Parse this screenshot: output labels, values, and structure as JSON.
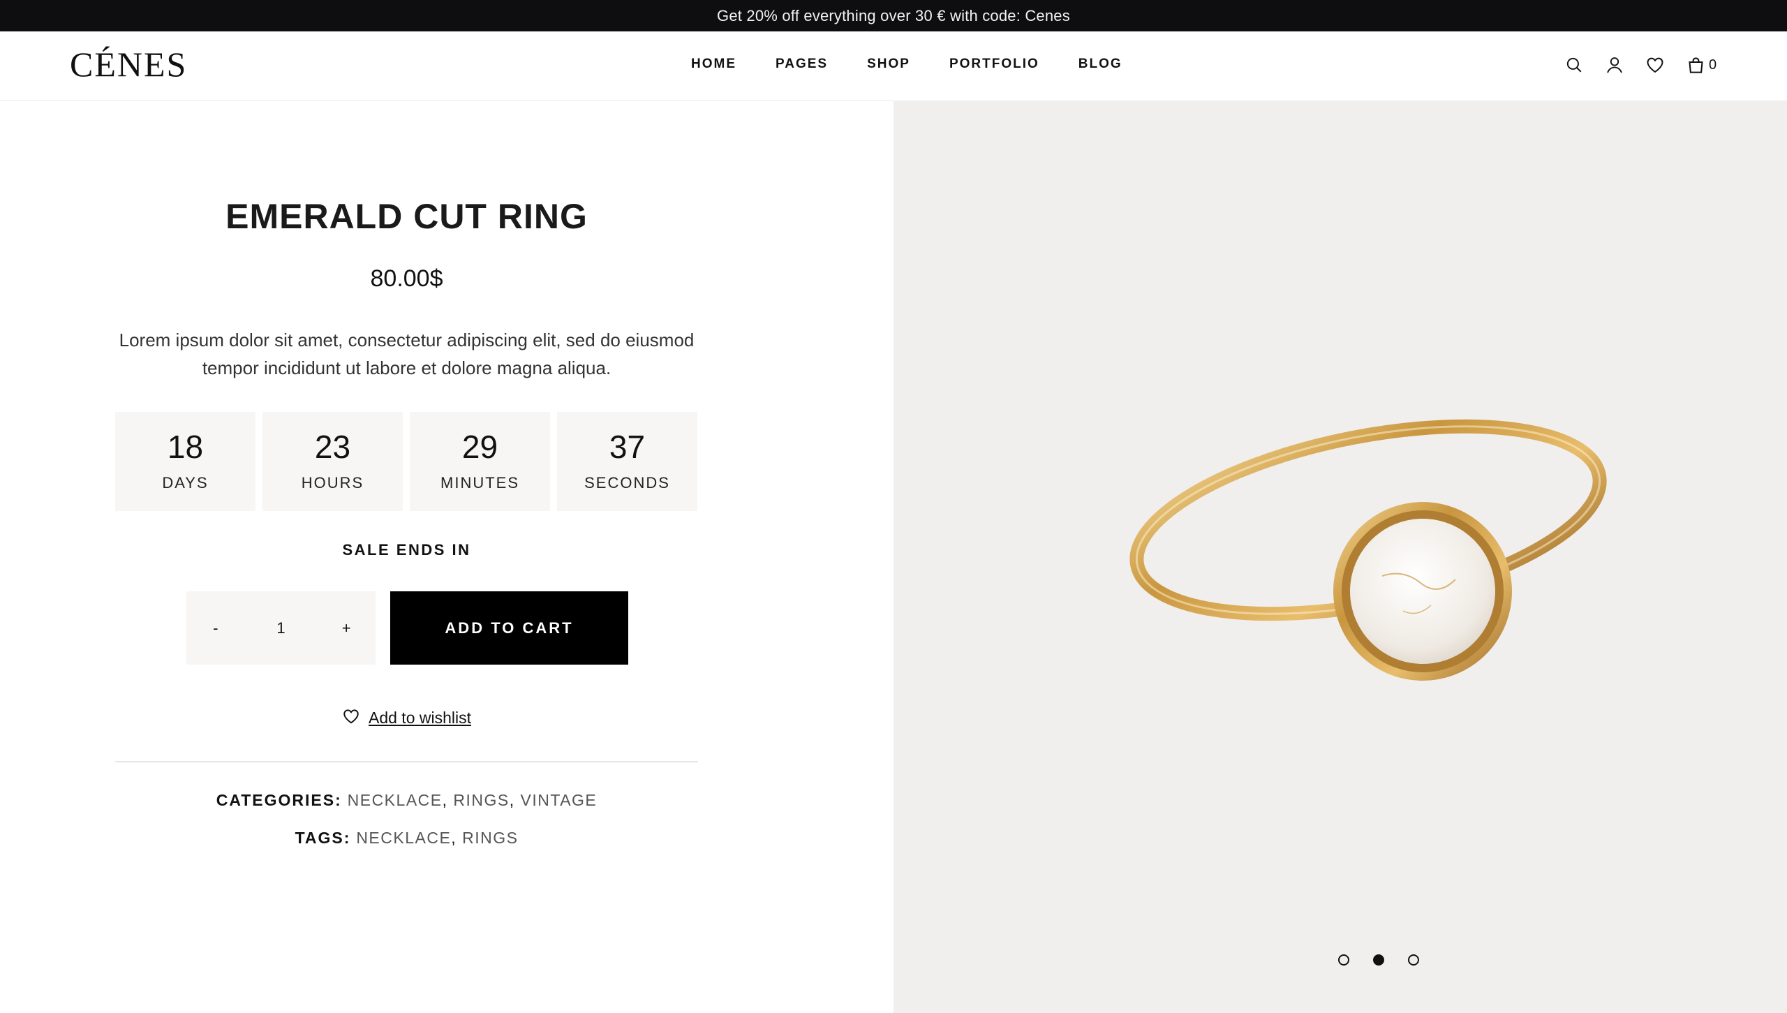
{
  "announcement": "Get 20% off everything over 30 € with code: Cenes",
  "header": {
    "logo": "CÉNES",
    "nav": [
      "HOME",
      "PAGES",
      "SHOP",
      "PORTFOLIO",
      "BLOG"
    ],
    "cart_count": "0",
    "icons": [
      "search-icon",
      "user-icon",
      "heart-icon",
      "bag-icon"
    ]
  },
  "product": {
    "title": "EMERALD CUT RING",
    "price": "80.00$",
    "description": "Lorem ipsum dolor sit amet, consectetur adipiscing elit, sed do eiusmod tempor incididunt ut labore et dolore magna aliqua.",
    "countdown": [
      {
        "value": "18",
        "label": "DAYS"
      },
      {
        "value": "23",
        "label": "HOURS"
      },
      {
        "value": "29",
        "label": "MINUTES"
      },
      {
        "value": "37",
        "label": "SECONDS"
      }
    ],
    "sale_label": "SALE ENDS IN",
    "quantity": {
      "minus": "-",
      "value": "1",
      "plus": "+"
    },
    "add_to_cart": "ADD TO CART",
    "wishlist": "Add to wishlist",
    "categories_label": "CATEGORIES:",
    "categories": [
      "NECKLACE",
      "RINGS",
      "VINTAGE"
    ],
    "tags_label": "TAGS:",
    "tags": [
      "NECKLACE",
      "RINGS"
    ]
  },
  "gallery": {
    "slides": 3,
    "active_slide": 2
  },
  "colors": {
    "topbar": "#0e0e10",
    "button": "#000000",
    "countdown_bg": "#f7f6f4",
    "gallery_bg": "#f0efed",
    "gold": "#c9963f"
  }
}
